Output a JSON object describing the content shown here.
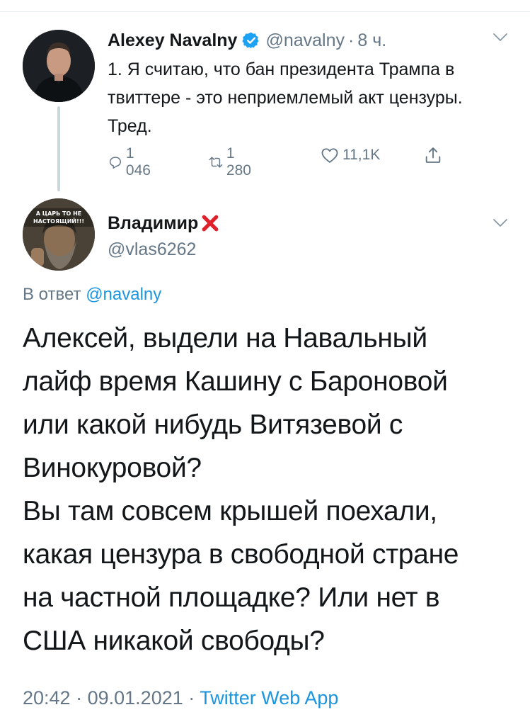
{
  "tweet1": {
    "name": "Alexey Navalny",
    "handle": "@navalny",
    "separator": "·",
    "time": "8 ч.",
    "text": "1. Я считаю, что бан президента Трампа в твиттере - это неприемлемый акт цензуры. Тред.",
    "replies": "1 046",
    "retweets": "1 280",
    "likes": "11,1K",
    "verified": true,
    "icons": [
      "verified-badge-icon",
      "chevron-down-icon",
      "reply-icon",
      "retweet-icon",
      "like-icon",
      "share-icon"
    ]
  },
  "tweet2": {
    "name": "Владимир",
    "handle": "@vlas6262",
    "avatar_caption": "А ЦАРЬ ТО НЕ НАСТОЯЩИЙ!!!",
    "reply_prefix": "В ответ",
    "reply_mention": "@navalny",
    "text_lines": [
      "Алексей, выдели на Навальный",
      "лайф время Кашину с Бароновой",
      "или какой нибудь Витязевой с",
      "Винокуровой?",
      "Вы там совсем крышей поехали,",
      "какая цензура в свободной стране",
      "на частной площадке? Или нет в",
      "США никакой свободы?"
    ],
    "time": "20:42",
    "date": "09.01.2021",
    "separator": "·",
    "source": "Twitter Web App",
    "icons": [
      "red-x-icon",
      "chevron-down-icon"
    ]
  },
  "colors": {
    "text": "#14171a",
    "secondary": "#657786",
    "link": "#1b95e0",
    "verified": "#1da1f2",
    "red_x": "#e0202a",
    "thread_line": "#ccd6dd"
  }
}
